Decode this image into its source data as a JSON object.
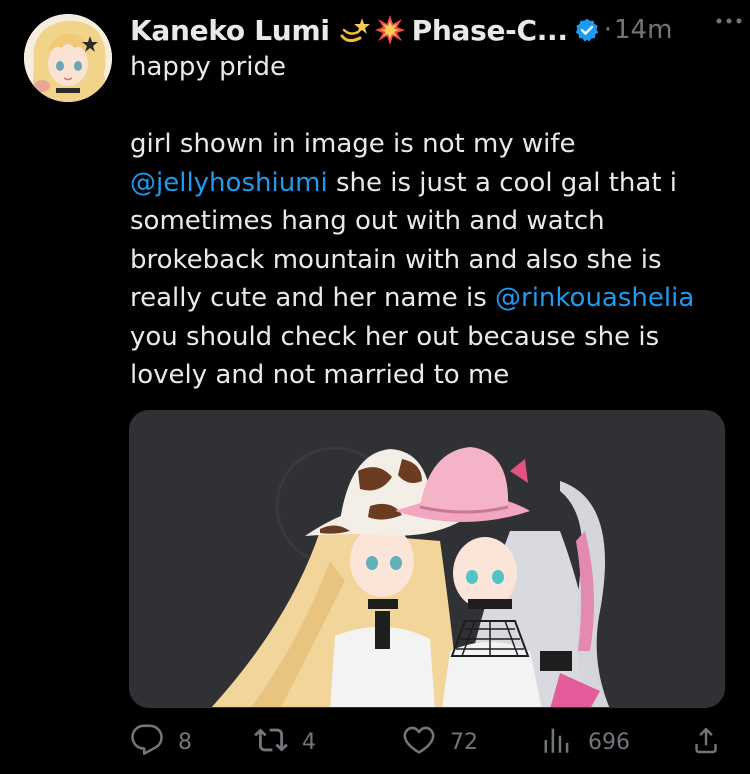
{
  "author": {
    "display_name": "Kaneko Lumi",
    "name_suffix": "Phase-C...",
    "emojis": [
      "dizzy-emoji",
      "collision-emoji"
    ],
    "time": "14m",
    "separator": "·"
  },
  "tweet": {
    "line1": "happy pride",
    "para1": "girl shown in image is not my wife",
    "mention1": "@jellyhoshiumi",
    "after_mention1": " she is just a cool gal that i sometimes hang out with and watch brokeback mountain with and also she is really cute and her name is ",
    "mention2": "@rinkouashelia",
    "after_mention2": " you should check her out because she is lovely and not married to me"
  },
  "actions": {
    "replies": "8",
    "retweets": "4",
    "likes": "72",
    "views": "696"
  },
  "colors": {
    "background": "#000000",
    "text": "#e7e9ea",
    "muted": "#71767b",
    "link": "#1d9bf0",
    "verified": "#1d9bf0"
  },
  "icons": [
    "more-icon",
    "verified-badge-icon",
    "reply-icon",
    "retweet-icon",
    "like-icon",
    "views-icon",
    "share-icon"
  ]
}
